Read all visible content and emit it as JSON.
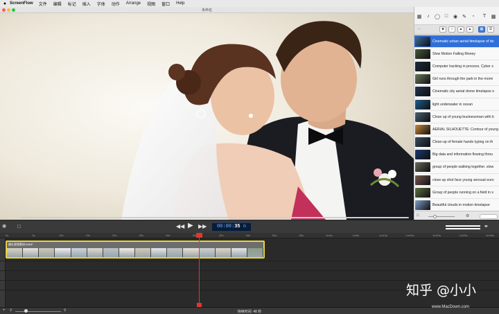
{
  "menubar": {
    "app_name": "ScreenFlow",
    "items": [
      "文件",
      "编辑",
      "标记",
      "插入",
      "字体",
      "动作",
      "Arrange",
      "视图",
      "窗口",
      "Help"
    ]
  },
  "window": {
    "title": "未命名"
  },
  "media_library": {
    "items": [
      {
        "label": "Cinematic urban aerial timelapse of do",
        "selected": true,
        "thumb": "#3f6ea0"
      },
      {
        "label": "Slow Motion Falling Money",
        "selected": false,
        "thumb": "#4a5a3a"
      },
      {
        "label": "Computer hacking in process. Cyber s",
        "selected": false,
        "thumb": "#1d2b3a"
      },
      {
        "label": "Girl runs through the park in the morni",
        "selected": false,
        "thumb": "#6b7a5a"
      },
      {
        "label": "Cinematic city aerial drone timelapse o",
        "selected": false,
        "thumb": "#24344f"
      },
      {
        "label": "light underwater in ocean",
        "selected": false,
        "thumb": "#1f5f8b"
      },
      {
        "label": "Close up of young businessman with b",
        "selected": false,
        "thumb": "#4d6070"
      },
      {
        "label": "AERIAL SILHOUETTE: Contour of young",
        "selected": false,
        "thumb": "#c9893a"
      },
      {
        "label": "Close-up of female hands typing on th",
        "selected": false,
        "thumb": "#3a4e60"
      },
      {
        "label": "Big data and information flowing throu",
        "selected": false,
        "thumb": "#1b3a6b"
      },
      {
        "label": "group of people walking together. slow",
        "selected": false,
        "thumb": "#6a6a5a"
      },
      {
        "label": "close up shot face young sensual euro",
        "selected": false,
        "thumb": "#7a5a50"
      },
      {
        "label": "Group of people running on a field in s",
        "selected": false,
        "thumb": "#5f7040"
      },
      {
        "label": "Beautiful clouds in motion timelapse",
        "selected": false,
        "thumb": "#7ea0c8"
      }
    ]
  },
  "transport": {
    "timecode_prefix": "00:00:",
    "timecode_main": "35",
    "timecode_suffix": "n"
  },
  "timeline": {
    "clip_label": "婚礼视频素材1080P",
    "ruler_ticks": [
      "0s",
      "5s",
      "10s",
      "15s",
      "20s",
      "25s",
      "30s",
      "35s",
      "40s",
      "45s",
      "50s",
      "55s",
      "1m0s",
      "1m5s",
      "1m10s",
      "1m15s",
      "1m20s",
      "1m25s",
      "1m30s"
    ],
    "frame_colors": [
      "#d8d2c0",
      "#e9e6dd",
      "#cfc7b4",
      "#eef1f4",
      "#c9d4dc",
      "#dedad0",
      "#b8c4cc",
      "#f0ede6",
      "#d2cab8",
      "#e5e9ec",
      "#bcc6c2",
      "#e8e3d6",
      "#cad2d6",
      "#ded6c6",
      "#e3e6e8",
      "#8c9e86"
    ]
  },
  "status": {
    "duration_text": "持续时间: 48 秒"
  },
  "watermarks": {
    "zhihu": "知乎 @小小",
    "site": "www.MacDown.com"
  },
  "colors": {
    "accent": "#2f6fd9",
    "clip_border": "#e9d53a",
    "playhead": "#e2362e"
  }
}
